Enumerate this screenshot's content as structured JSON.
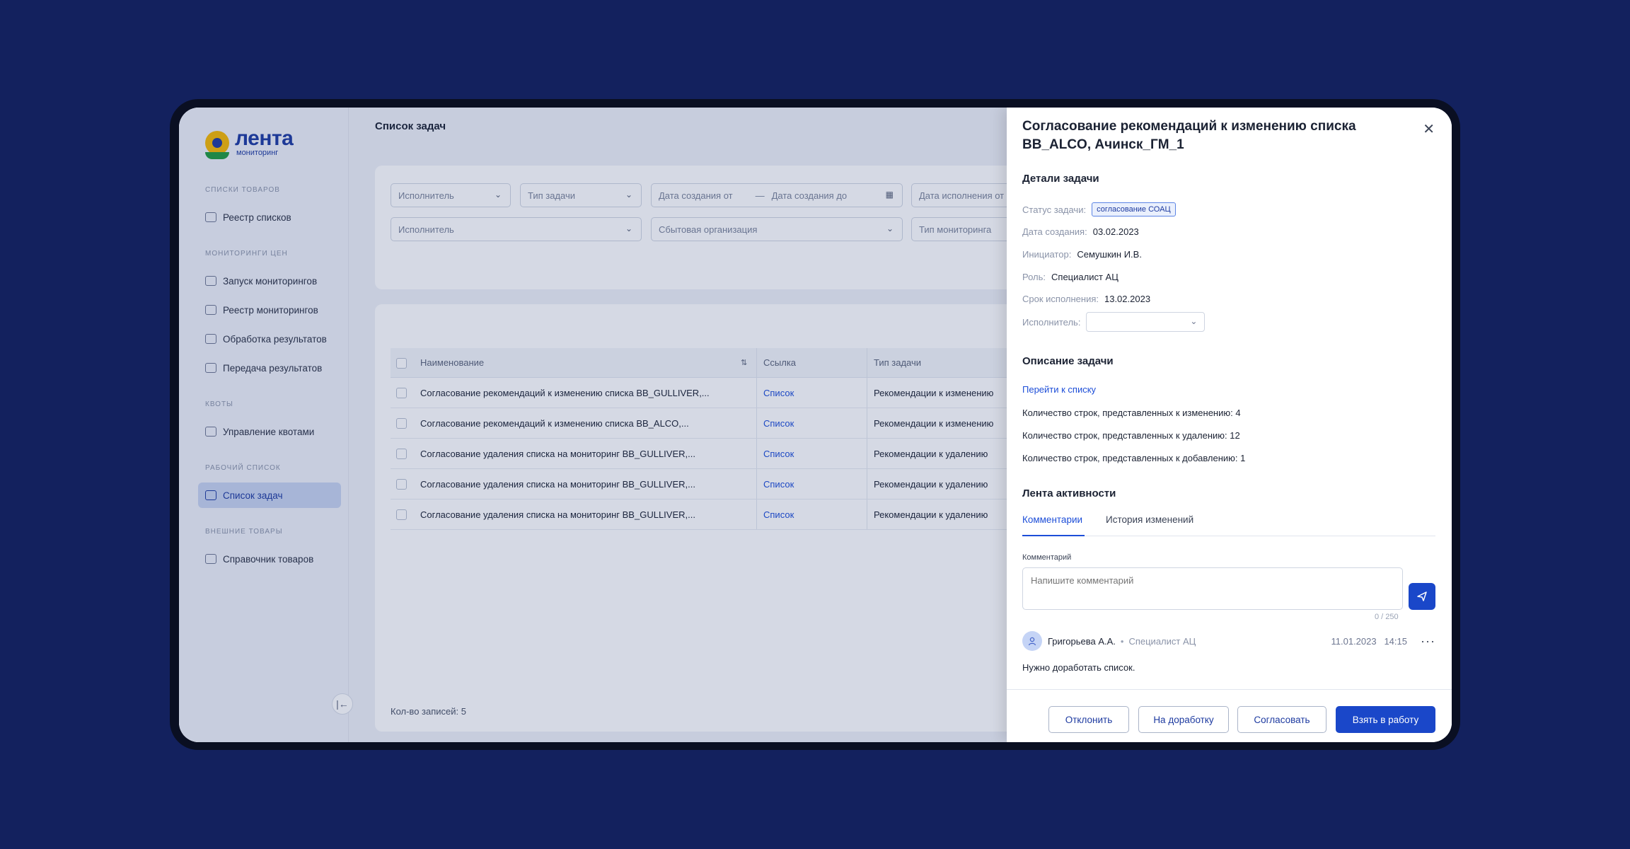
{
  "logo": {
    "name": "лента",
    "sub": "мониторинг"
  },
  "sidebar": {
    "sections": [
      {
        "title": "Списки товаров",
        "items": [
          "Реестр списков"
        ]
      },
      {
        "title": "Мониторинги цен",
        "items": [
          "Запуск мониторингов",
          "Реестр мониторингов",
          "Обработка результатов",
          "Передача результатов"
        ]
      },
      {
        "title": "Квоты",
        "items": [
          "Управление квотами"
        ]
      },
      {
        "title": "Рабочий список",
        "items": [
          "Список задач"
        ]
      },
      {
        "title": "Внешние товары",
        "items": [
          "Справочник товаров"
        ]
      }
    ],
    "active_item": "Список задач",
    "collapse_icon": "collapse-left-icon"
  },
  "main": {
    "title": "Список задач",
    "filters": {
      "row1": [
        "Исполнитель",
        "Тип задачи",
        "Дата создания от",
        "Дата создания до",
        "Дата исполнения от"
      ],
      "row2": [
        "Исполнитель",
        "Сбытовая организация",
        "Тип мониторинга"
      ]
    },
    "table": {
      "columns": [
        "Наименование",
        "Ссылка",
        "Тип задачи"
      ],
      "rows": [
        {
          "name": "Согласование рекомендаций к изменению списка BB_GULLIVER,...",
          "link": "Список",
          "type": "Рекомендации к изменению"
        },
        {
          "name": "Согласование рекомендаций к изменению списка BB_ALCO,...",
          "link": "Список",
          "type": "Рекомендации к изменению"
        },
        {
          "name": "Согласование удаления списка на мониторинг BB_GULLIVER,...",
          "link": "Список",
          "type": "Рекомендации к удалению"
        },
        {
          "name": "Согласование удаления списка на мониторинг BB_GULLIVER,...",
          "link": "Список",
          "type": "Рекомендации к удалению"
        },
        {
          "name": "Согласование удаления списка на мониторинг BB_GULLIVER,...",
          "link": "Список",
          "type": "Рекомендации к удалению"
        }
      ],
      "count_label": "Кол-во записей: 5"
    }
  },
  "drawer": {
    "title": "Согласование рекомендаций к изменению списка BB_ALCO, Ачинск_ГМ_1",
    "details_heading": "Детали задачи",
    "status_label": "Статус задачи:",
    "status_value": "согласование СОАЦ",
    "created_label": "Дата создания:",
    "created_value": "03.02.2023",
    "initiator_label": "Инициатор:",
    "initiator_value": "Семушкин И.В.",
    "role_label": "Роль:",
    "role_value": "Специалист АЦ",
    "deadline_label": "Срок исполнения:",
    "deadline_value": "13.02.2023",
    "executor_label": "Исполнитель:",
    "executor_value": "",
    "description_heading": "Описание задачи",
    "goto_link": "Перейти к списку",
    "desc_lines": [
      {
        "label": "Количество строк, представленных к изменению:",
        "value": "4"
      },
      {
        "label": "Количество строк, представленных к удалению:",
        "value": "12"
      },
      {
        "label": "Количество строк, представленных к добавлению:",
        "value": "1"
      }
    ],
    "activity_heading": "Лента активности",
    "tabs": [
      "Комментарии",
      "История изменений"
    ],
    "comment_label": "Комментарий",
    "comment_placeholder": "Напишите комментарий",
    "comment_counter": "0 / 250",
    "comment": {
      "author": "Григорьева А.А.",
      "role": "Специалист АЦ",
      "date": "11.01.2023",
      "time": "14:15",
      "text": "Нужно доработать список."
    },
    "buttons": {
      "reject": "Отклонить",
      "rework": "На доработку",
      "approve": "Согласовать",
      "take": "Взять в работу"
    }
  },
  "colors": {
    "background": "#13215e",
    "accent": "#1a47c9",
    "link": "#1d4ed8"
  }
}
